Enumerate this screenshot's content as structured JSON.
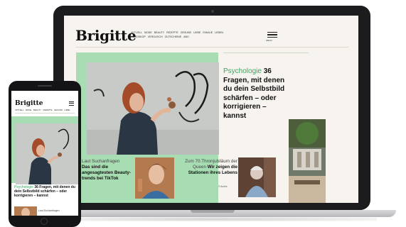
{
  "laptop": {
    "logo": "Brigitte",
    "nav_items": [
      "AKTUELL",
      "MODE",
      "BEAUTY",
      "REZEPTE",
      "GESUND",
      "LIEBE",
      "FAMILIE",
      "LEBEN",
      "HOROSKOP",
      "VERGLEICH",
      "GUTSCHEINE",
      "ABO"
    ],
    "menu_label": "MENÜ",
    "hero": {
      "kicker": "Psychologie",
      "headline": " 36 Fragen, mit denen du dein Selbstbild schärfen – oder korrigieren – kannst"
    },
    "card1": {
      "kicker": "Laut Suchanfragen",
      "headline": "Das sind die angesagtesten Beauty-trends bei TikTok"
    },
    "card2": {
      "kicker": "Zum 70.Thronjubiläum der Queen",
      "headline": "Wir zeigen die Stationen ihres Lebens",
      "byline": "© Archiv"
    }
  },
  "phone": {
    "logo": "Brigitte",
    "nav_items": [
      "AKTUELL",
      "MODE",
      "BEAUTY",
      "REZEPTE",
      "GESUND",
      "LIEBE"
    ],
    "hero": {
      "kicker": "Psychologie",
      "headline": " 36 Fragen, mit denen du dein Selbstbild schärfen – oder korrigieren – kannst"
    },
    "next_kicker": "Laut Suchanfragen"
  },
  "colors": {
    "accent_mint": "#a8dcb3",
    "kicker_green": "#3aa560",
    "device_dark": "#1c1c1e"
  },
  "icons": [
    "hamburger-menu-icon"
  ]
}
